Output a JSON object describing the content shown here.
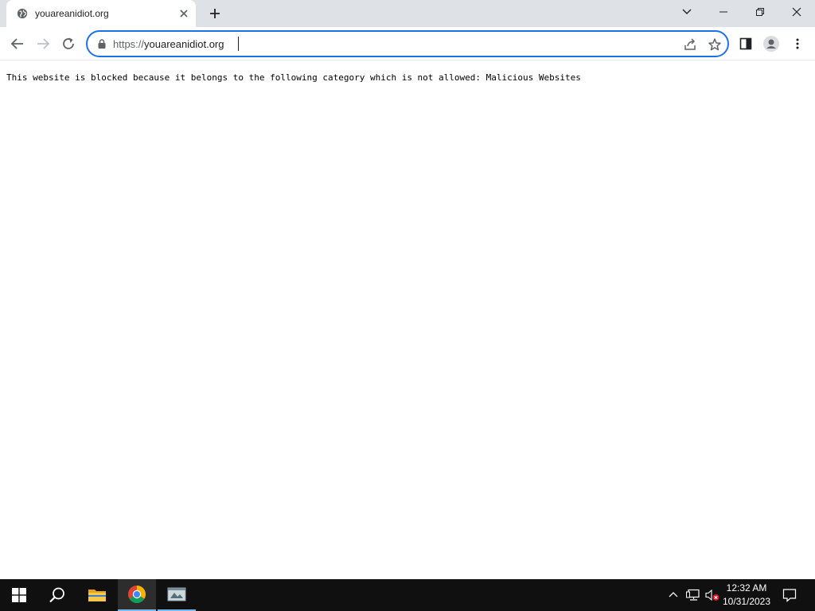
{
  "browser": {
    "tab": {
      "title": "youareanidiot.org"
    },
    "address_bar": {
      "scheme": "https://",
      "host": "youareanidiot.org"
    }
  },
  "page": {
    "message": "This website is blocked because it belongs to the following category which is not allowed: Malicious Websites"
  },
  "taskbar": {
    "time": "12:32 AM",
    "date": "10/31/2023"
  },
  "colors": {
    "accent": "#1a73e8",
    "tabstrip": "#dee1e6",
    "taskbar": "#101010",
    "taskbar_active_indicator": "#76b9ed"
  },
  "icons": {
    "tab_favicon": "globe-icon",
    "tab_close": "close-icon",
    "new_tab": "plus-icon",
    "tab_search": "chevron-down-icon",
    "minimize": "minimize-icon",
    "restore": "restore-icon",
    "close_window": "close-icon",
    "back": "back-arrow-icon",
    "forward": "forward-arrow-icon",
    "reload": "reload-icon",
    "lock": "lock-icon",
    "share": "share-icon",
    "bookmark": "star-icon",
    "side_panel": "side-panel-icon",
    "profile": "profile-icon",
    "menu": "kebab-menu-icon",
    "start": "windows-logo-icon",
    "search": "search-icon",
    "file_explorer": "folder-icon",
    "chrome": "chrome-icon",
    "app": "app-window-icon",
    "show_hidden": "chevron-up-icon",
    "network": "network-icon",
    "volume": "volume-muted-icon",
    "notifications": "notification-icon"
  }
}
